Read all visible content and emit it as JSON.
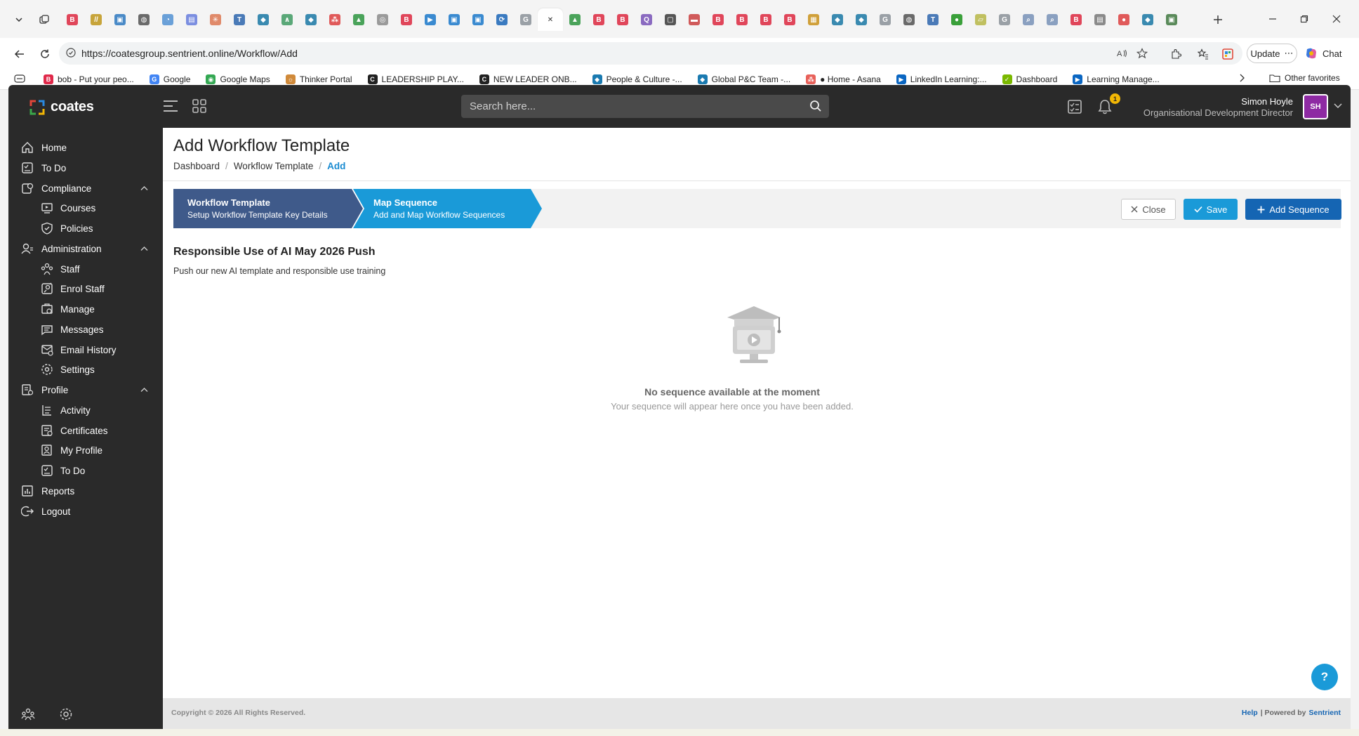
{
  "browser": {
    "url": "https://coatesgroup.sentrient.online/Workflow/Add",
    "update_label": "Update",
    "chat_label": "Chat",
    "tab_favicons": [
      {
        "color": "#e0465a",
        "glyph": "B"
      },
      {
        "color": "#c7a43a",
        "glyph": "//"
      },
      {
        "color": "#4a8ac7",
        "glyph": "▣"
      },
      {
        "color": "#6a6a6a",
        "glyph": "◍"
      },
      {
        "color": "#6aa0d8",
        "glyph": "◔"
      },
      {
        "color": "#7b8ee0",
        "glyph": "▤"
      },
      {
        "color": "#e08a6a",
        "glyph": "✳"
      },
      {
        "color": "#4a7ab7",
        "glyph": "T"
      },
      {
        "color": "#3a8ab0",
        "glyph": "◆"
      },
      {
        "color": "#5aa878",
        "glyph": "∧"
      },
      {
        "color": "#3a8ab0",
        "glyph": "◆"
      },
      {
        "color": "#e05a5a",
        "glyph": "⁂"
      },
      {
        "color": "#4aa35a",
        "glyph": "▲"
      },
      {
        "color": "#9a9a9a",
        "glyph": "◎"
      },
      {
        "color": "#e0465a",
        "glyph": "B"
      },
      {
        "color": "#3a8ad0",
        "glyph": "▶"
      },
      {
        "color": "#3a8ad0",
        "glyph": "▣"
      },
      {
        "color": "#3a8ad0",
        "glyph": "▣"
      },
      {
        "color": "#3a7ac0",
        "glyph": "⟳"
      },
      {
        "color": "#9aa0a6",
        "glyph": "G"
      },
      {
        "color": "#ffffff",
        "glyph": "✕",
        "active": true
      },
      {
        "color": "#4aa35a",
        "glyph": "▲"
      },
      {
        "color": "#e0465a",
        "glyph": "B"
      },
      {
        "color": "#e0465a",
        "glyph": "B"
      },
      {
        "color": "#8a6ac0",
        "glyph": "Q"
      },
      {
        "color": "#555555",
        "glyph": "▢"
      },
      {
        "color": "#d05a5a",
        "glyph": "▬"
      },
      {
        "color": "#e0465a",
        "glyph": "B"
      },
      {
        "color": "#e0465a",
        "glyph": "B"
      },
      {
        "color": "#e0465a",
        "glyph": "B"
      },
      {
        "color": "#e0465a",
        "glyph": "B"
      },
      {
        "color": "#d0a03a",
        "glyph": "▦"
      },
      {
        "color": "#3a8ab0",
        "glyph": "◆"
      },
      {
        "color": "#3a8ab0",
        "glyph": "◆"
      },
      {
        "color": "#9aa0a6",
        "glyph": "G"
      },
      {
        "color": "#6a6a6a",
        "glyph": "◍"
      },
      {
        "color": "#4a7ab7",
        "glyph": "T"
      },
      {
        "color": "#3aa03a",
        "glyph": "●"
      },
      {
        "color": "#c0c060",
        "glyph": "▱"
      },
      {
        "color": "#9aa0a6",
        "glyph": "G"
      },
      {
        "color": "#8aa0c0",
        "glyph": "⌕"
      },
      {
        "color": "#8aa0c0",
        "glyph": "⌕"
      },
      {
        "color": "#e0465a",
        "glyph": "B"
      },
      {
        "color": "#8a8a8a",
        "glyph": "▤"
      },
      {
        "color": "#e05a5a",
        "glyph": "●"
      },
      {
        "color": "#3a8ab0",
        "glyph": "◆"
      },
      {
        "color": "#5a8a5a",
        "glyph": "▣"
      }
    ],
    "favorites": [
      {
        "label": "bob - Put your peo...",
        "color": "#e0294a",
        "glyph": "B"
      },
      {
        "label": "Google",
        "color": "#4285f4",
        "glyph": "G"
      },
      {
        "label": "Google Maps",
        "color": "#34a853",
        "glyph": "◉"
      },
      {
        "label": "Thinker Portal",
        "color": "#d08a3a",
        "glyph": "☼"
      },
      {
        "label": "LEADERSHIP PLAY...",
        "color": "#222222",
        "glyph": "C"
      },
      {
        "label": "NEW LEADER ONB...",
        "color": "#222222",
        "glyph": "C"
      },
      {
        "label": "People & Culture -...",
        "color": "#1a7ab0",
        "glyph": "◆"
      },
      {
        "label": "Global P&C Team -...",
        "color": "#1a7ab0",
        "glyph": "◆"
      },
      {
        "label": "● Home - Asana",
        "color": "#e8615a",
        "glyph": "⁂"
      },
      {
        "label": "LinkedIn Learning:...",
        "color": "#0a66c2",
        "glyph": "▶"
      },
      {
        "label": "Dashboard",
        "color": "#7ab800",
        "glyph": "✓"
      },
      {
        "label": "Learning Manage...",
        "color": "#0a66c2",
        "glyph": "▶"
      }
    ],
    "other_favorites": "Other favorites"
  },
  "app": {
    "logo_text": "coates",
    "search_placeholder": "Search here...",
    "notification_count": "1",
    "user_name": "Simon Hoyle",
    "user_role": "Organisational Development Director",
    "avatar_initials": "SH",
    "avatar_color": "#8e2aa3"
  },
  "sidebar": {
    "items": [
      {
        "label": "Home",
        "icon": "home-icon"
      },
      {
        "label": "To Do",
        "icon": "todo-icon"
      },
      {
        "label": "Compliance",
        "icon": "compliance-icon",
        "expanded": true
      },
      {
        "label": "Courses",
        "icon": "courses-icon"
      },
      {
        "label": "Policies",
        "icon": "policies-icon"
      },
      {
        "label": "Administration",
        "icon": "administration-icon",
        "expanded": true
      },
      {
        "label": "Staff",
        "icon": "staff-icon"
      },
      {
        "label": "Enrol Staff",
        "icon": "enrol-staff-icon"
      },
      {
        "label": "Manage",
        "icon": "manage-icon"
      },
      {
        "label": "Messages",
        "icon": "messages-icon"
      },
      {
        "label": "Email History",
        "icon": "email-history-icon"
      },
      {
        "label": "Settings",
        "icon": "settings-icon"
      },
      {
        "label": "Profile",
        "icon": "profile-icon",
        "expanded": true
      },
      {
        "label": "Activity",
        "icon": "activity-icon"
      },
      {
        "label": "Certificates",
        "icon": "certificates-icon"
      },
      {
        "label": "My Profile",
        "icon": "my-profile-icon"
      },
      {
        "label": "To Do",
        "icon": "todo-icon"
      },
      {
        "label": "Reports",
        "icon": "reports-icon"
      },
      {
        "label": "Logout",
        "icon": "logout-icon"
      }
    ]
  },
  "page": {
    "title": "Add Workflow Template",
    "breadcrumb": [
      "Dashboard",
      "Workflow Template",
      "Add"
    ],
    "steps": [
      {
        "title": "Workflow Template",
        "subtitle": "Setup Workflow Template Key Details"
      },
      {
        "title": "Map Sequence",
        "subtitle": "Add and Map Workflow Sequences"
      }
    ],
    "buttons": {
      "close": "Close",
      "save": "Save",
      "add_sequence": "Add Sequence"
    },
    "template_name": "Responsible Use of AI May 2026 Push",
    "template_description": "Push our new AI template and responsible use training",
    "empty_title": "No sequence available at the moment",
    "empty_subtitle": "Your sequence will appear here once you have been added.",
    "help_fab": "?"
  },
  "footer": {
    "copyright": "Copyright © 2026 All Rights Reserved.",
    "help": "Help",
    "powered_by": "| Powered by",
    "brand": "Sentrient"
  },
  "colors": {
    "app_dark": "#2a2a2a",
    "step_active": "#3f5a8a",
    "step_current": "#1a9ad8",
    "primary_dark": "#1565b3",
    "accent": "#1a9ad8"
  }
}
